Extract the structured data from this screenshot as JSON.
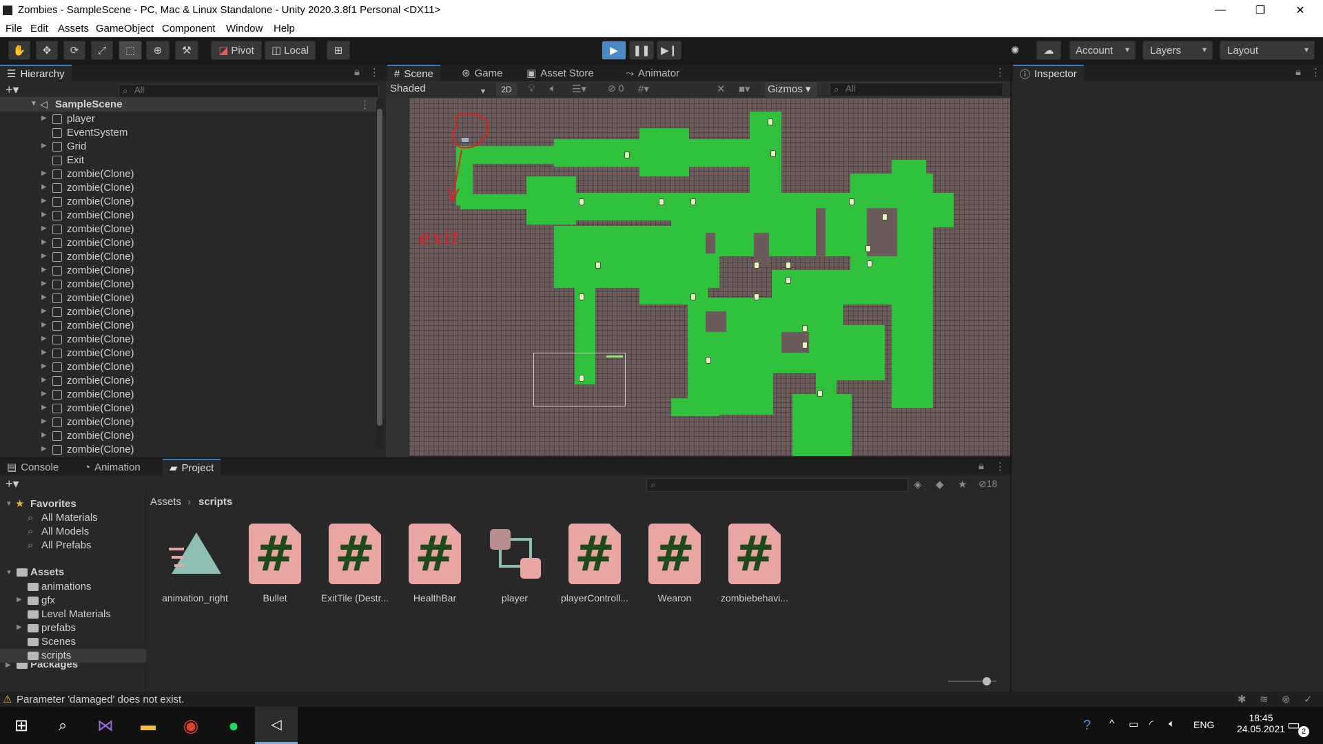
{
  "window": {
    "title": "Zombies - SampleScene - PC, Mac & Linux Standalone - Unity 2020.3.8f1 Personal <DX11>",
    "minimize": "—",
    "maximize": "❐",
    "close": "✕"
  },
  "menu": [
    "File",
    "Edit",
    "Assets",
    "GameObject",
    "Component",
    "Window",
    "Help"
  ],
  "toolbar": {
    "pivot": "Pivot",
    "local": "Local",
    "account": "Account",
    "layers": "Layers",
    "layout": "Layout"
  },
  "hierarchy": {
    "tab": "Hierarchy",
    "search_placeholder": "All",
    "scene_name": "SampleScene",
    "items": [
      {
        "label": "player",
        "has_children": true
      },
      {
        "label": "EventSystem",
        "has_children": false
      },
      {
        "label": "Grid",
        "has_children": true
      },
      {
        "label": "Exit",
        "has_children": false
      },
      {
        "label": "zombie(Clone)",
        "has_children": true
      },
      {
        "label": "zombie(Clone)",
        "has_children": true
      },
      {
        "label": "zombie(Clone)",
        "has_children": true
      },
      {
        "label": "zombie(Clone)",
        "has_children": true
      },
      {
        "label": "zombie(Clone)",
        "has_children": true
      },
      {
        "label": "zombie(Clone)",
        "has_children": true
      },
      {
        "label": "zombie(Clone)",
        "has_children": true
      },
      {
        "label": "zombie(Clone)",
        "has_children": true
      },
      {
        "label": "zombie(Clone)",
        "has_children": true
      },
      {
        "label": "zombie(Clone)",
        "has_children": true
      },
      {
        "label": "zombie(Clone)",
        "has_children": true
      },
      {
        "label": "zombie(Clone)",
        "has_children": true
      },
      {
        "label": "zombie(Clone)",
        "has_children": true
      },
      {
        "label": "zombie(Clone)",
        "has_children": true
      },
      {
        "label": "zombie(Clone)",
        "has_children": true
      },
      {
        "label": "zombie(Clone)",
        "has_children": true
      },
      {
        "label": "zombie(Clone)",
        "has_children": true
      },
      {
        "label": "zombie(Clone)",
        "has_children": true
      },
      {
        "label": "zombie(Clone)",
        "has_children": true
      },
      {
        "label": "zombie(Clone)",
        "has_children": true
      },
      {
        "label": "zombie(Clone)",
        "has_children": true
      }
    ]
  },
  "scene": {
    "tabs": [
      "Scene",
      "Game",
      "Asset Store",
      "Animator"
    ],
    "shading": "Shaded",
    "mode_2d": "2D",
    "hidden_count": "0",
    "gizmos": "Gizmos",
    "search_placeholder": "All",
    "annotation_text": "exit",
    "colors": {
      "ground": "#2fc03c",
      "wall": "#6b5b5b",
      "annotation": "#e02020"
    }
  },
  "inspector": {
    "tab": "Inspector"
  },
  "bottom": {
    "tabs": [
      "Console",
      "Animation",
      "Project"
    ],
    "hidden_count": "18",
    "breadcrumb": [
      "Assets",
      "scripts"
    ],
    "favorites": {
      "label": "Favorites",
      "items": [
        "All Materials",
        "All Models",
        "All Prefabs"
      ]
    },
    "assets": {
      "label": "Assets",
      "folders": [
        {
          "label": "animations",
          "has_children": false
        },
        {
          "label": "gfx",
          "has_children": true
        },
        {
          "label": "Level Materials",
          "has_children": false
        },
        {
          "label": "prefabs",
          "has_children": true
        },
        {
          "label": "Scenes",
          "has_children": false
        },
        {
          "label": "scripts",
          "has_children": false
        }
      ]
    },
    "packages": "Packages",
    "files": [
      {
        "label": "animation_right",
        "icon": "animation-clip-icon"
      },
      {
        "label": "Bullet",
        "icon": "csharp-script-icon"
      },
      {
        "label": "ExitTile (Destr...",
        "icon": "csharp-script-icon"
      },
      {
        "label": "HealthBar",
        "icon": "csharp-script-icon"
      },
      {
        "label": "player",
        "icon": "animator-controller-icon"
      },
      {
        "label": "playerControll...",
        "icon": "csharp-script-icon"
      },
      {
        "label": "Wearon",
        "icon": "csharp-script-icon"
      },
      {
        "label": "zombiebehavi...",
        "icon": "csharp-script-icon"
      }
    ],
    "script_glyph": "#"
  },
  "status": {
    "message": "Parameter 'damaged' does not exist."
  },
  "taskbar": {
    "lang": "ENG",
    "time": "18:45",
    "date": "24.05.2021",
    "notif_count": "2"
  }
}
